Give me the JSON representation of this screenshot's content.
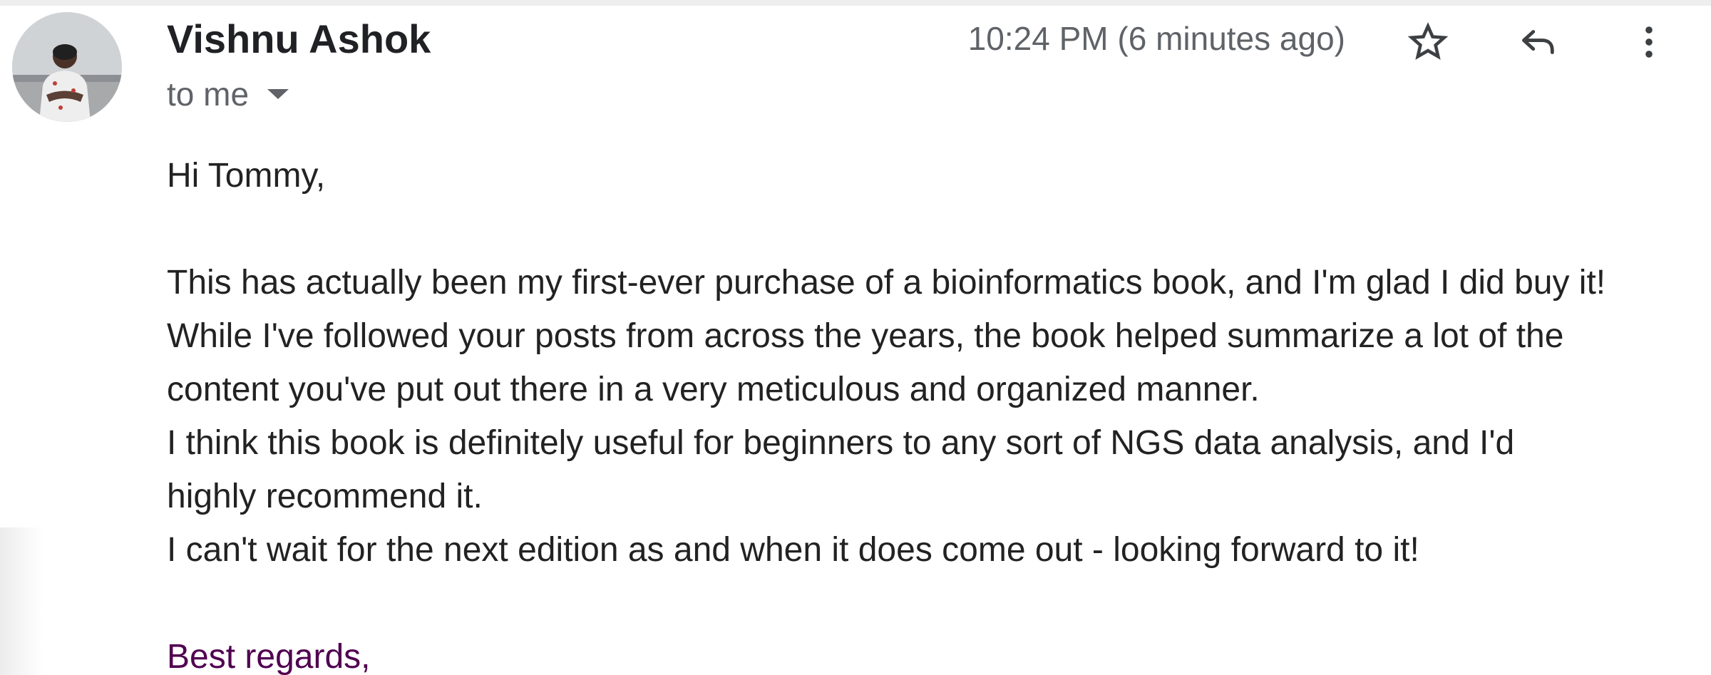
{
  "message": {
    "sender": {
      "name": "Vishnu Ashok",
      "avatar_icon": "profile-photo"
    },
    "recipient_label": "to me",
    "timestamp": "10:24 PM (6 minutes ago)",
    "actions": {
      "star_icon": "star-outline-icon",
      "reply_icon": "reply-arrow-icon",
      "more_icon": "vertical-dots-icon"
    },
    "body": {
      "greeting": "Hi Tommy,",
      "lines": [
        "This has actually been my first-ever purchase of a bioinformatics book, and I'm glad I did buy it!",
        "While I've followed your posts from across the years, the book helped summarize a lot of the",
        "content you've put out there in a very meticulous and organized manner.",
        "I think this book is definitely useful for beginners to any sort of NGS data analysis, and I'd",
        "highly recommend it.",
        "I can't wait for the next edition as and when it does come out - looking forward to it!"
      ],
      "signoff": "Best regards,"
    },
    "colors": {
      "sender_name": "#202124",
      "secondary_text": "#5f6368",
      "body_text": "#222222",
      "quoted_text": "#500050"
    }
  }
}
